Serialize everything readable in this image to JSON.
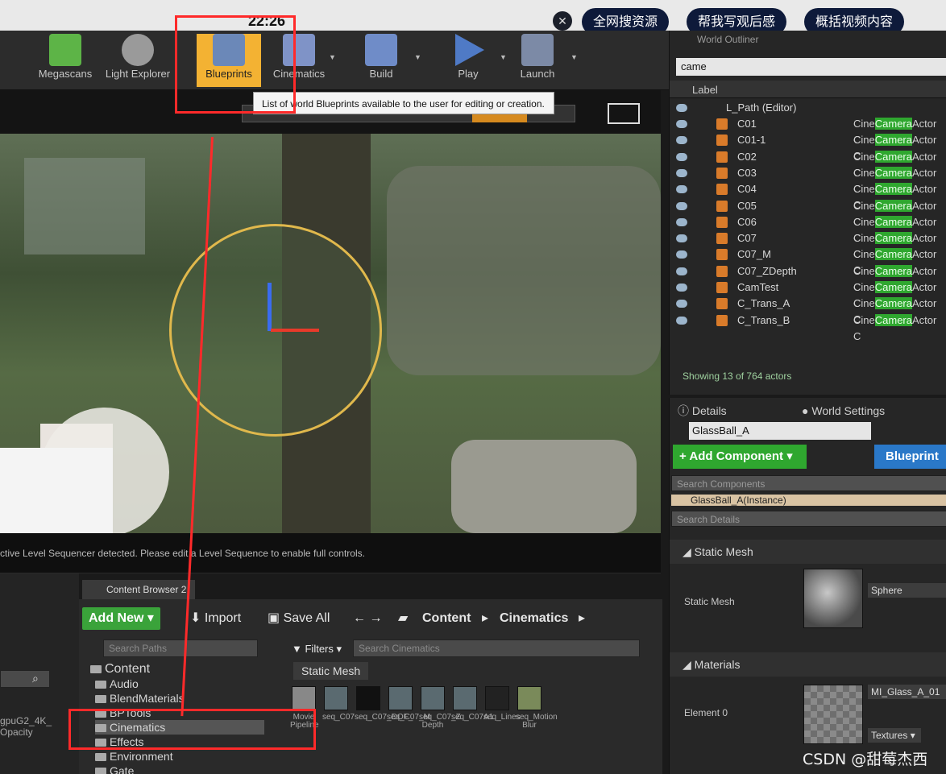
{
  "clock": "22:26",
  "overlay_buttons": [
    "全网搜资源",
    "帮我写观后感",
    "概括视频内容"
  ],
  "toolbar": {
    "items": [
      {
        "label": "Megascans",
        "color": "#5db447"
      },
      {
        "label": "Light Explorer",
        "color": "#9a9a9a"
      },
      {
        "label": "Blueprints",
        "color": "#6b88b8"
      },
      {
        "label": "Cinematics",
        "color": "#7f93c7"
      },
      {
        "label": "Build",
        "color": "#6f8cc8"
      },
      {
        "label": "Play",
        "color": "#4f7ac6"
      },
      {
        "label": "Launch",
        "color": "#7c8aa6"
      }
    ],
    "tooltip": "List of world Blueprints available to the user for editing or creation."
  },
  "viewport": {
    "status": "ctive Level Sequencer detected. Please edit a Level Sequence to enable full controls."
  },
  "content_browser": {
    "tab": "Content Browser 2",
    "add_new": "Add New",
    "import": "Import",
    "save_all": "Save All",
    "path": [
      "Content",
      "Cinematics"
    ],
    "search_paths": "Search Paths",
    "filters": "Filters",
    "search_assets": "Search Cinematics",
    "filter_chip": "Static Mesh",
    "tree": [
      "Content",
      "Audio",
      "BlendMaterials",
      "BPTools",
      "Cinematics",
      "Effects",
      "Environment",
      "Gate"
    ],
    "assets": [
      "Movie Pipeline",
      "seq_C07",
      "seq_C07_DOF_",
      "seq_C07_M",
      "seq_C07_Z Depth",
      "seq_C07A1",
      "seq_Lines",
      "seq_Motion Blur"
    ],
    "left_dock_label": "gpuG2_4K_ Opacity"
  },
  "outliner": {
    "title": "World Outliner",
    "search": "came",
    "column": "Label",
    "root": "L_Path (Editor)",
    "rows": [
      {
        "name": "C01",
        "type_pre": "Cine",
        "type_hl": "Camera",
        "type_post": "Actor C"
      },
      {
        "name": "C01-1",
        "type_pre": "Cine",
        "type_hl": "Camera",
        "type_post": "Actor C"
      },
      {
        "name": "C02",
        "type_pre": "Cine",
        "type_hl": "Camera",
        "type_post": "Actor C"
      },
      {
        "name": "C03",
        "type_pre": "Cine",
        "type_hl": "Camera",
        "type_post": "Actor C"
      },
      {
        "name": "C04",
        "type_pre": "Cine",
        "type_hl": "Camera",
        "type_post": "Actor C"
      },
      {
        "name": "C05",
        "type_pre": "Cine",
        "type_hl": "Camera",
        "type_post": "Actor C"
      },
      {
        "name": "C06",
        "type_pre": "Cine",
        "type_hl": "Camera",
        "type_post": "Actor C"
      },
      {
        "name": "C07",
        "type_pre": "Cine",
        "type_hl": "Camera",
        "type_post": "Actor C"
      },
      {
        "name": "C07_M",
        "type_pre": "Cine",
        "type_hl": "Camera",
        "type_post": "Actor C"
      },
      {
        "name": "C07_ZDepth",
        "type_pre": "Cine",
        "type_hl": "Camera",
        "type_post": "Actor C"
      },
      {
        "name": "CamTest",
        "type_pre": "Cine",
        "type_hl": "Camera",
        "type_post": "Actor C"
      },
      {
        "name": "C_Trans_A",
        "type_pre": "Cine",
        "type_hl": "Camera",
        "type_post": "Actor C"
      },
      {
        "name": "C_Trans_B",
        "type_pre": "Cine",
        "type_hl": "Camera",
        "type_post": "Actor C"
      }
    ],
    "footer": "Showing 13 of 764 actors"
  },
  "details": {
    "tab_details": "Details",
    "tab_world": "World Settings",
    "object_name": "GlassBall_A",
    "add_component": "+ Add Component",
    "blueprint": "Blueprint",
    "search_components": "Search Components",
    "instance": "GlassBall_A(Instance)",
    "search_details": "Search Details",
    "sec_static_mesh": "Static Mesh",
    "prop_static_mesh": "Static Mesh",
    "mesh_value": "Sphere",
    "sec_materials": "Materials",
    "prop_element": "Element 0",
    "material_value": "MI_Glass_A_01",
    "textures": "Textures"
  },
  "watermark": "CSDN @甜莓杰西"
}
